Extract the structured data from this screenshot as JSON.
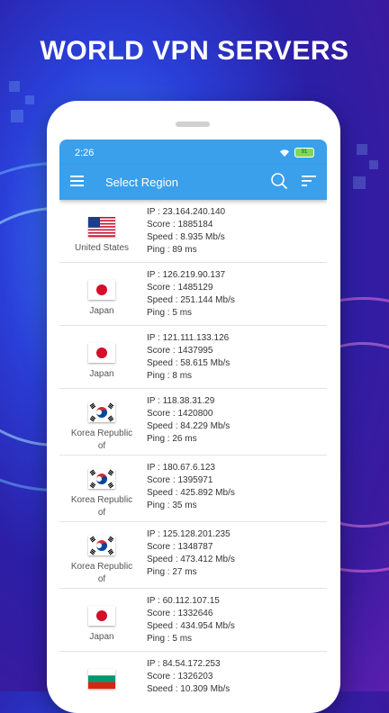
{
  "headline": "WORLD VPN SERVERS",
  "status_bar": {
    "time": "2:26",
    "battery": "91"
  },
  "toolbar": {
    "title": "Select Region"
  },
  "servers": [
    {
      "country": "United States",
      "flag": "us",
      "ip": "IP : 23.164.240.140",
      "score": "Score : 1885184",
      "speed": "Speed : 8.935 Mb/s",
      "ping": "Ping : 89 ms"
    },
    {
      "country": "Japan",
      "flag": "jp",
      "ip": "IP : 126.219.90.137",
      "score": "Score : 1485129",
      "speed": "Speed : 251.144 Mb/s",
      "ping": "Ping : 5 ms"
    },
    {
      "country": "Japan",
      "flag": "jp",
      "ip": "IP : 121.111.133.126",
      "score": "Score : 1437995",
      "speed": "Speed : 58.615 Mb/s",
      "ping": "Ping : 8 ms"
    },
    {
      "country": "Korea Republic of",
      "flag": "kr",
      "ip": "IP : 118.38.31.29",
      "score": "Score : 1420800",
      "speed": "Speed : 84.229 Mb/s",
      "ping": "Ping : 26 ms"
    },
    {
      "country": "Korea Republic of",
      "flag": "kr",
      "ip": "IP : 180.67.6.123",
      "score": "Score : 1395971",
      "speed": "Speed : 425.892 Mb/s",
      "ping": "Ping : 35 ms"
    },
    {
      "country": "Korea Republic of",
      "flag": "kr",
      "ip": "IP : 125.128.201.235",
      "score": "Score : 1348787",
      "speed": "Speed : 473.412 Mb/s",
      "ping": "Ping : 27 ms"
    },
    {
      "country": "Japan",
      "flag": "jp",
      "ip": "IP : 60.112.107.15",
      "score": "Score : 1332646",
      "speed": "Speed : 434.954 Mb/s",
      "ping": "Ping : 5 ms"
    },
    {
      "country": "Bulgaria",
      "flag": "bg",
      "ip": "IP : 84.54.172.253",
      "score": "Score : 1326203",
      "speed": "Speed : 10.309 Mb/s",
      "ping": ""
    }
  ],
  "icons": {
    "menu": "hamburger-icon",
    "search": "search-icon",
    "sort": "sort-icon",
    "wifi": "wifi-icon",
    "battery": "battery-icon"
  },
  "colors": {
    "toolbar": "#3aa0ec",
    "background": "#2b1fa6"
  }
}
